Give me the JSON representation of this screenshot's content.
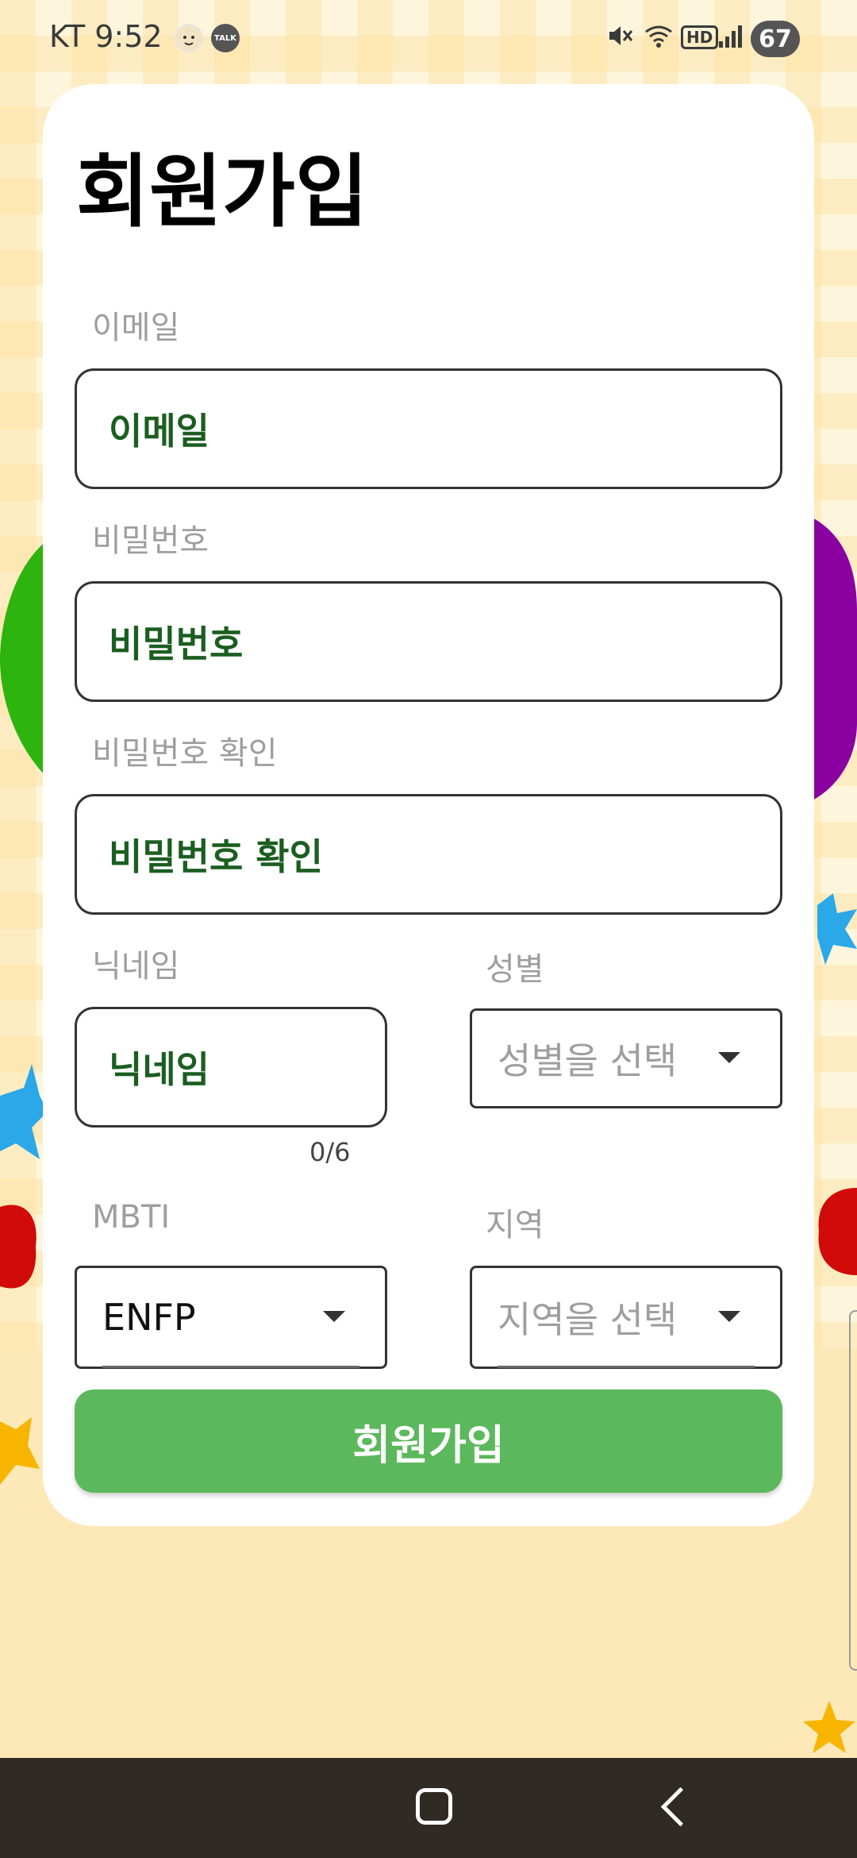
{
  "status_bar": {
    "carrier_time": "KT 9:52",
    "notification_icons": [
      "face-icon",
      "talk-icon"
    ],
    "talk_badge": "TALK",
    "system_icons": [
      "mute-icon",
      "wifi-icon",
      "hd-icon",
      "signal-icon"
    ],
    "hd_label": "HD",
    "battery_level": "67"
  },
  "page": {
    "title": "회원가입"
  },
  "form": {
    "email": {
      "label": "이메일",
      "placeholder": "이메일"
    },
    "password": {
      "label": "비밀번호",
      "placeholder": "비밀번호"
    },
    "password_confirm": {
      "label": "비밀번호 확인",
      "placeholder": "비밀번호 확인"
    },
    "nickname": {
      "label": "닉네임",
      "placeholder": "닉네임",
      "counter": "0/6"
    },
    "gender": {
      "label": "성별",
      "value": "성별을 선택"
    },
    "mbti": {
      "label": "MBTI",
      "value": "ENFP"
    },
    "region": {
      "label": "지역",
      "value": "지역을 선택"
    },
    "submit_label": "회원가입"
  },
  "colors": {
    "accent_green": "#5cb85c",
    "field_text_green": "#1b5e20",
    "background_cream": "#fef6dc",
    "nav_bar": "#302a24"
  },
  "nav_bar": {
    "icons": [
      "home-icon",
      "back-icon"
    ]
  }
}
